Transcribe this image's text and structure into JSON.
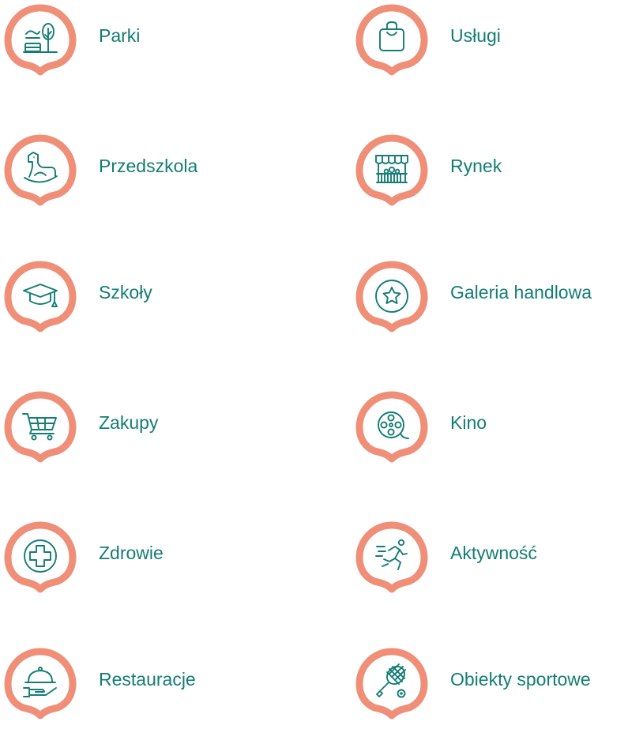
{
  "colors": {
    "pin_accent": "#f08f78",
    "icon_color": "#137d74",
    "label_color": "#137d74",
    "background": "#ffffff"
  },
  "legend": {
    "left": [
      {
        "label": "Parki",
        "icon": "park-icon"
      },
      {
        "label": "Przedszkola",
        "icon": "rocking-horse-icon"
      },
      {
        "label": "Szkoły",
        "icon": "graduation-cap-icon"
      },
      {
        "label": "Zakupy",
        "icon": "shopping-cart-icon"
      },
      {
        "label": "Zdrowie",
        "icon": "medical-cross-icon"
      },
      {
        "label": "Restauracje",
        "icon": "serving-cloche-icon"
      }
    ],
    "right": [
      {
        "label": "Usługi",
        "icon": "shopping-bag-icon"
      },
      {
        "label": "Rynek",
        "icon": "market-stall-icon"
      },
      {
        "label": "Galeria handlowa",
        "icon": "star-icon"
      },
      {
        "label": "Kino",
        "icon": "film-reel-icon"
      },
      {
        "label": "Aktywność",
        "icon": "runner-icon"
      },
      {
        "label": "Obiekty sportowe",
        "icon": "tennis-racket-icon"
      }
    ]
  }
}
